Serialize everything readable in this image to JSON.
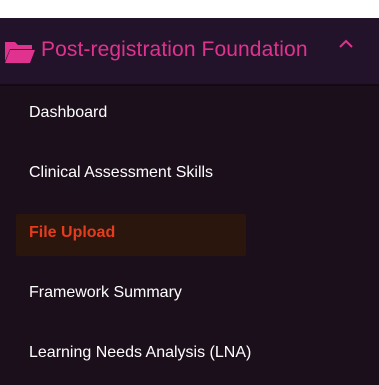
{
  "header": {
    "title": "Post-registration Foundation",
    "icon": "folder-open-icon",
    "toggle_icon": "chevron-up-icon",
    "title_color": "#e0328f"
  },
  "menu": {
    "items": [
      {
        "label": "Dashboard",
        "active": false
      },
      {
        "label": "Clinical Assessment Skills",
        "active": false
      },
      {
        "label": "File Upload",
        "active": true
      },
      {
        "label": "Framework Summary",
        "active": false
      },
      {
        "label": "Learning Needs Analysis (LNA)",
        "active": false
      }
    ],
    "active_color": "#e33d1e"
  },
  "colors": {
    "background": "#1c0f1c",
    "header_background": "#22132a"
  }
}
